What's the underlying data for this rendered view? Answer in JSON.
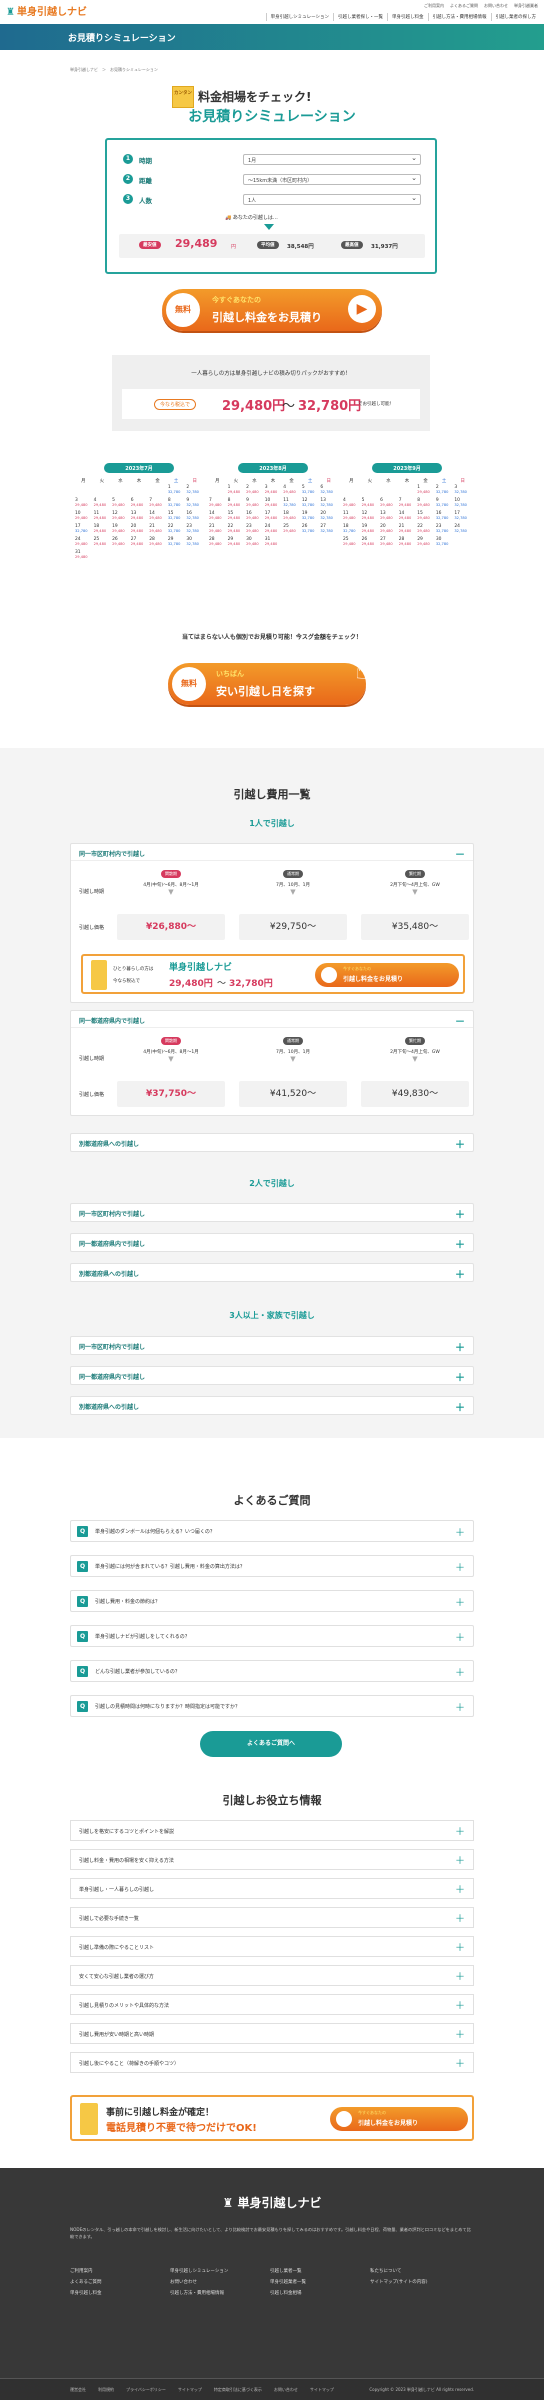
{
  "header": {
    "logo": "単身引越しナビ",
    "toplinks": [
      "ご利用案内",
      "よくあるご質問",
      "お問い合わせ",
      "単身引越業者"
    ],
    "nav": [
      "単身引越しシミュレーション",
      "引越し業者探し・一覧",
      "単身引越し料金",
      "引越し方法・費用相場情報",
      "引越し業者の探し方"
    ]
  },
  "band": {
    "title": "お見積りシミュレーション"
  },
  "breadcrumb": "単身引越しナビ　＞　お見積りシミュレーション",
  "hero": {
    "kana": "カンタン",
    "line1": "料金相場をチェック!",
    "line2": "お見積りシミュレーション"
  },
  "form": {
    "rows": [
      {
        "n": "1",
        "label": "時期",
        "value": "1月"
      },
      {
        "n": "2",
        "label": "距離",
        "value": "〜15km未満（市区町村内）"
      },
      {
        "n": "3",
        "label": "人数",
        "value": "1人"
      }
    ],
    "result_caption": "あなたの引越しは…",
    "min_label": "最安値",
    "min_value": "29,489",
    "yen": "円",
    "avg_label": "平均値",
    "avg_value": "38,548円",
    "max_label": "最高値",
    "max_value": "31,937円"
  },
  "cta1": {
    "badge": "無料",
    "top": "今すぐあなたの",
    "main": "引越し料金をお見積り"
  },
  "pack": {
    "text": "一人暮らしの方は単身引越しナビの積み切りパックがおすすめ！",
    "now": "今なら税込で",
    "price1": "29,480円",
    "tilde": "〜",
    "price2": "32,780円",
    "tail": "でお引越し可能！"
  },
  "calendars": [
    {
      "title": "2023年7月",
      "days": [
        "月",
        "火",
        "水",
        "木",
        "金",
        "土",
        "日"
      ],
      "cells": [
        [
          "",
          "",
          ""
        ],
        [
          "",
          "",
          ""
        ],
        [
          "",
          "",
          ""
        ],
        [
          "",
          "",
          ""
        ],
        [
          "",
          "",
          ""
        ],
        [
          "1",
          "32,780"
        ],
        [
          "2",
          "32,780"
        ],
        [
          "3",
          "29,480"
        ],
        [
          "4",
          "29,480"
        ],
        [
          "5",
          "29,480"
        ],
        [
          "6",
          "29,480"
        ],
        [
          "7",
          "29,480"
        ],
        [
          "8",
          "32,780"
        ],
        [
          "9",
          "32,780"
        ],
        [
          "10",
          "29,480"
        ],
        [
          "11",
          "29,480"
        ],
        [
          "12",
          "29,480"
        ],
        [
          "13",
          "29,480"
        ],
        [
          "14",
          "29,480"
        ],
        [
          "15",
          "32,780"
        ],
        [
          "16",
          "32,780"
        ],
        [
          "17",
          "32,780"
        ],
        [
          "18",
          "29,480"
        ],
        [
          "19",
          "29,480"
        ],
        [
          "20",
          "29,480"
        ],
        [
          "21",
          "29,480"
        ],
        [
          "22",
          "32,780"
        ],
        [
          "23",
          "32,780"
        ],
        [
          "24",
          "29,480"
        ],
        [
          "25",
          "29,480"
        ],
        [
          "26",
          "29,480"
        ],
        [
          "27",
          "29,480"
        ],
        [
          "28",
          "29,480"
        ],
        [
          "29",
          "32,780"
        ],
        [
          "30",
          "32,780"
        ],
        [
          "31",
          "29,480"
        ]
      ]
    },
    {
      "title": "2023年8月",
      "days": [
        "月",
        "火",
        "水",
        "木",
        "金",
        "土",
        "日"
      ],
      "cells": [
        [
          "",
          ""
        ],
        [
          "1",
          "29,480"
        ],
        [
          "2",
          "29,480"
        ],
        [
          "3",
          "29,480"
        ],
        [
          "4",
          "29,480"
        ],
        [
          "5",
          "32,780"
        ],
        [
          "6",
          "32,780"
        ],
        [
          "7",
          "29,480"
        ],
        [
          "8",
          "29,480"
        ],
        [
          "9",
          "29,480"
        ],
        [
          "10",
          "29,480"
        ],
        [
          "11",
          "32,780"
        ],
        [
          "12",
          "32,780"
        ],
        [
          "13",
          "32,780"
        ],
        [
          "14",
          "29,480"
        ],
        [
          "15",
          "29,480"
        ],
        [
          "16",
          "29,480"
        ],
        [
          "17",
          "29,480"
        ],
        [
          "18",
          "29,480"
        ],
        [
          "19",
          "32,780"
        ],
        [
          "20",
          "32,780"
        ],
        [
          "21",
          "29,480"
        ],
        [
          "22",
          "29,480"
        ],
        [
          "23",
          "29,480"
        ],
        [
          "24",
          "29,480"
        ],
        [
          "25",
          "29,480"
        ],
        [
          "26",
          "32,780"
        ],
        [
          "27",
          "32,780"
        ],
        [
          "28",
          "29,480"
        ],
        [
          "29",
          "29,480"
        ],
        [
          "30",
          "29,480"
        ],
        [
          "31",
          "29,480"
        ]
      ]
    },
    {
      "title": "2023年9月",
      "days": [
        "月",
        "火",
        "水",
        "木",
        "金",
        "土",
        "日"
      ],
      "cells": [
        [
          "",
          ""
        ],
        [
          "",
          ""
        ],
        [
          "",
          ""
        ],
        [
          "",
          ""
        ],
        [
          "1",
          "29,480"
        ],
        [
          "2",
          "32,780"
        ],
        [
          "3",
          "32,780"
        ],
        [
          "4",
          "29,480"
        ],
        [
          "5",
          "29,480"
        ],
        [
          "6",
          "29,480"
        ],
        [
          "7",
          "29,480"
        ],
        [
          "8",
          "29,480"
        ],
        [
          "9",
          "32,780"
        ],
        [
          "10",
          "32,780"
        ],
        [
          "11",
          "29,480"
        ],
        [
          "12",
          "29,480"
        ],
        [
          "13",
          "29,480"
        ],
        [
          "14",
          "29,480"
        ],
        [
          "15",
          "29,480"
        ],
        [
          "16",
          "32,780"
        ],
        [
          "17",
          "32,780"
        ],
        [
          "18",
          "32,780"
        ],
        [
          "19",
          "29,480"
        ],
        [
          "20",
          "29,480"
        ],
        [
          "21",
          "29,480"
        ],
        [
          "22",
          "29,480"
        ],
        [
          "23",
          "32,780"
        ],
        [
          "24",
          "32,780"
        ],
        [
          "25",
          "29,480"
        ],
        [
          "26",
          "29,480"
        ],
        [
          "27",
          "29,480"
        ],
        [
          "28",
          "29,480"
        ],
        [
          "29",
          "29,480"
        ],
        [
          "30",
          "32,780"
        ]
      ]
    }
  ],
  "cta2": {
    "lead": "当てはまらない人も個別でお見積り可能！今スグ金額をチェック！",
    "badge": "無料",
    "top": "いちばん",
    "main": "安い引越し日を探す"
  },
  "costs": {
    "title": "引越し費用一覧",
    "one": "1人で引越し",
    "two": "2人で引越し",
    "three": "3人以上・家族で引越し",
    "acc1": {
      "title": "同一市区町村内で引越し",
      "period_label": "引越し時期",
      "price_label": "引越し価格",
      "cols": [
        {
          "tag": "閑散期",
          "period": "4月(中旬)〜6月、8月〜1月",
          "price": "¥26,880〜"
        },
        {
          "tag": "通常期",
          "period": "7月、10月、1月",
          "price": "¥29,750〜"
        },
        {
          "tag": "繁忙期",
          "period": "2月下旬〜4月上旬、GW",
          "price": "¥35,480〜"
        }
      ]
    },
    "banner": {
      "line1": "ひとり暮らしの方は",
      "line2": "今なら税込で",
      "brand": "単身引越しナビ",
      "p1": "29,480円",
      "tilde": "〜",
      "p2": "32,780円",
      "btn": "引越し料金をお見積り",
      "btnsub": "今すぐあなたの"
    },
    "acc2": {
      "title": "同一都道府県内で引越し",
      "cols": [
        {
          "tag": "閑散期",
          "period": "4月(中旬)〜6月、8月〜1月",
          "price": "¥37,750〜"
        },
        {
          "tag": "通常期",
          "period": "7月、10月、1月",
          "price": "¥41,520〜"
        },
        {
          "tag": "繁忙期",
          "period": "2月下旬〜4月上旬、GW",
          "price": "¥49,830〜"
        }
      ]
    },
    "acc3": "別都道府県への引越し",
    "two_items": [
      "同一市区町村内で引越し",
      "同一都道府県内で引越し",
      "別都道府県への引越し"
    ],
    "three_items": [
      "同一市区町村内で引越し",
      "同一都道府県内で引越し",
      "別都道府県への引越し"
    ]
  },
  "faq": {
    "title": "よくあるご質問",
    "items": [
      "単身引越のダンボールは何個もらえる？いつ届くの？",
      "単身引越には何が含まれている？引越し費用・料金の算出方法は？",
      "引越し費用・料金の節約は？",
      "単身引越しナビが引越しをしてくれるの？",
      "どんな引越し業者が参加しているの？",
      "引越しの見積時間は何時になりますか？時間指定は可能ですか？"
    ],
    "more": "よくあるご質問へ"
  },
  "info": {
    "title": "引越しお役立ち情報",
    "items": [
      "引越しを格安にするコツとポイントを解説",
      "引越し料金・費用の相場を安く抑える方法",
      "単身引越し・一人暮らしの引越し",
      "引越しで必要な手続き一覧",
      "引越し準備の際にやることリスト",
      "安くて安心な引越し業者の選び方",
      "引越し見積りのメリットや具体的な方法",
      "引越し費用が安い時期と高い時期",
      "引越し後にやること（荷解きの手順やコツ）"
    ]
  },
  "banner2": {
    "line1": "事前に引越し料金が確定！",
    "line2": "電話見積り不要で待つだけでOK!",
    "btn": "引越し料金をお見積り",
    "btnsub": "今すぐあなたの"
  },
  "footer": {
    "logo": "単身引越しナビ",
    "desc": "NODEのレンタル、引っ越しの本命で引越しを検討し、新生活に向けたいとして、より比較検討でお最安見積もりを探してみるのはおすすめです。引越し料金や日程、荷物量、業者の評判と口コミなどをまとめて比較できます。",
    "cols": [
      [
        "ご利用案内",
        "よくあるご質問",
        "単身引越し料金"
      ],
      [
        "単身引越しシミュレーション",
        "お問い合わせ",
        "引越し方法・費用相場情報"
      ],
      [
        "引越し業者一覧",
        "単身引越業者一覧",
        "引越し料金相場"
      ],
      [
        "私たちについて",
        "サイトマップ(サイトの内容)"
      ]
    ],
    "bottom": [
      "運営会社",
      "利用規約",
      "プライバシーポリシー",
      "サイトマップ",
      "特定商取引法に基づく表示",
      "お問い合わせ",
      "サイトマップ"
    ],
    "copy": "Copyright © 2023 単身引越しナビ All rights reserved."
  },
  "colors": {
    "teal": "#1a9b96",
    "orange": "#e9681a",
    "red": "#d63a5e"
  }
}
